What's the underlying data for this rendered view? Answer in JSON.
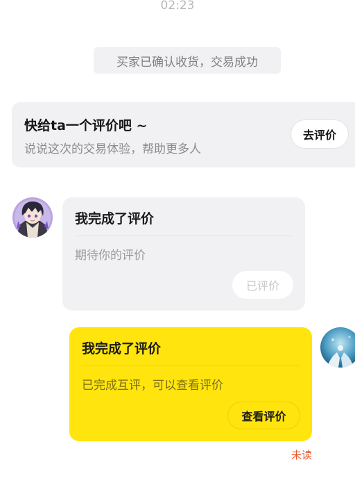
{
  "status_time": "02:23",
  "system_message": "买家已确认收货，交易成功",
  "review_prompt": {
    "title": "快给ta一个评价吧 ~",
    "subtitle": "说说这次的交易体验，帮助更多人",
    "button": "去评价"
  },
  "messages": [
    {
      "side": "left",
      "title": "我完成了评价",
      "text": "期待你的评价",
      "button": "已评价"
    },
    {
      "side": "right",
      "title": "我完成了评价",
      "text": "已完成互评，可以查看评价",
      "button": "查看评价",
      "read_status": "未读"
    }
  ],
  "colors": {
    "accent_yellow": "#ffe40d",
    "card_gray": "#f1f1f3",
    "unread_red": "#e8572c"
  }
}
